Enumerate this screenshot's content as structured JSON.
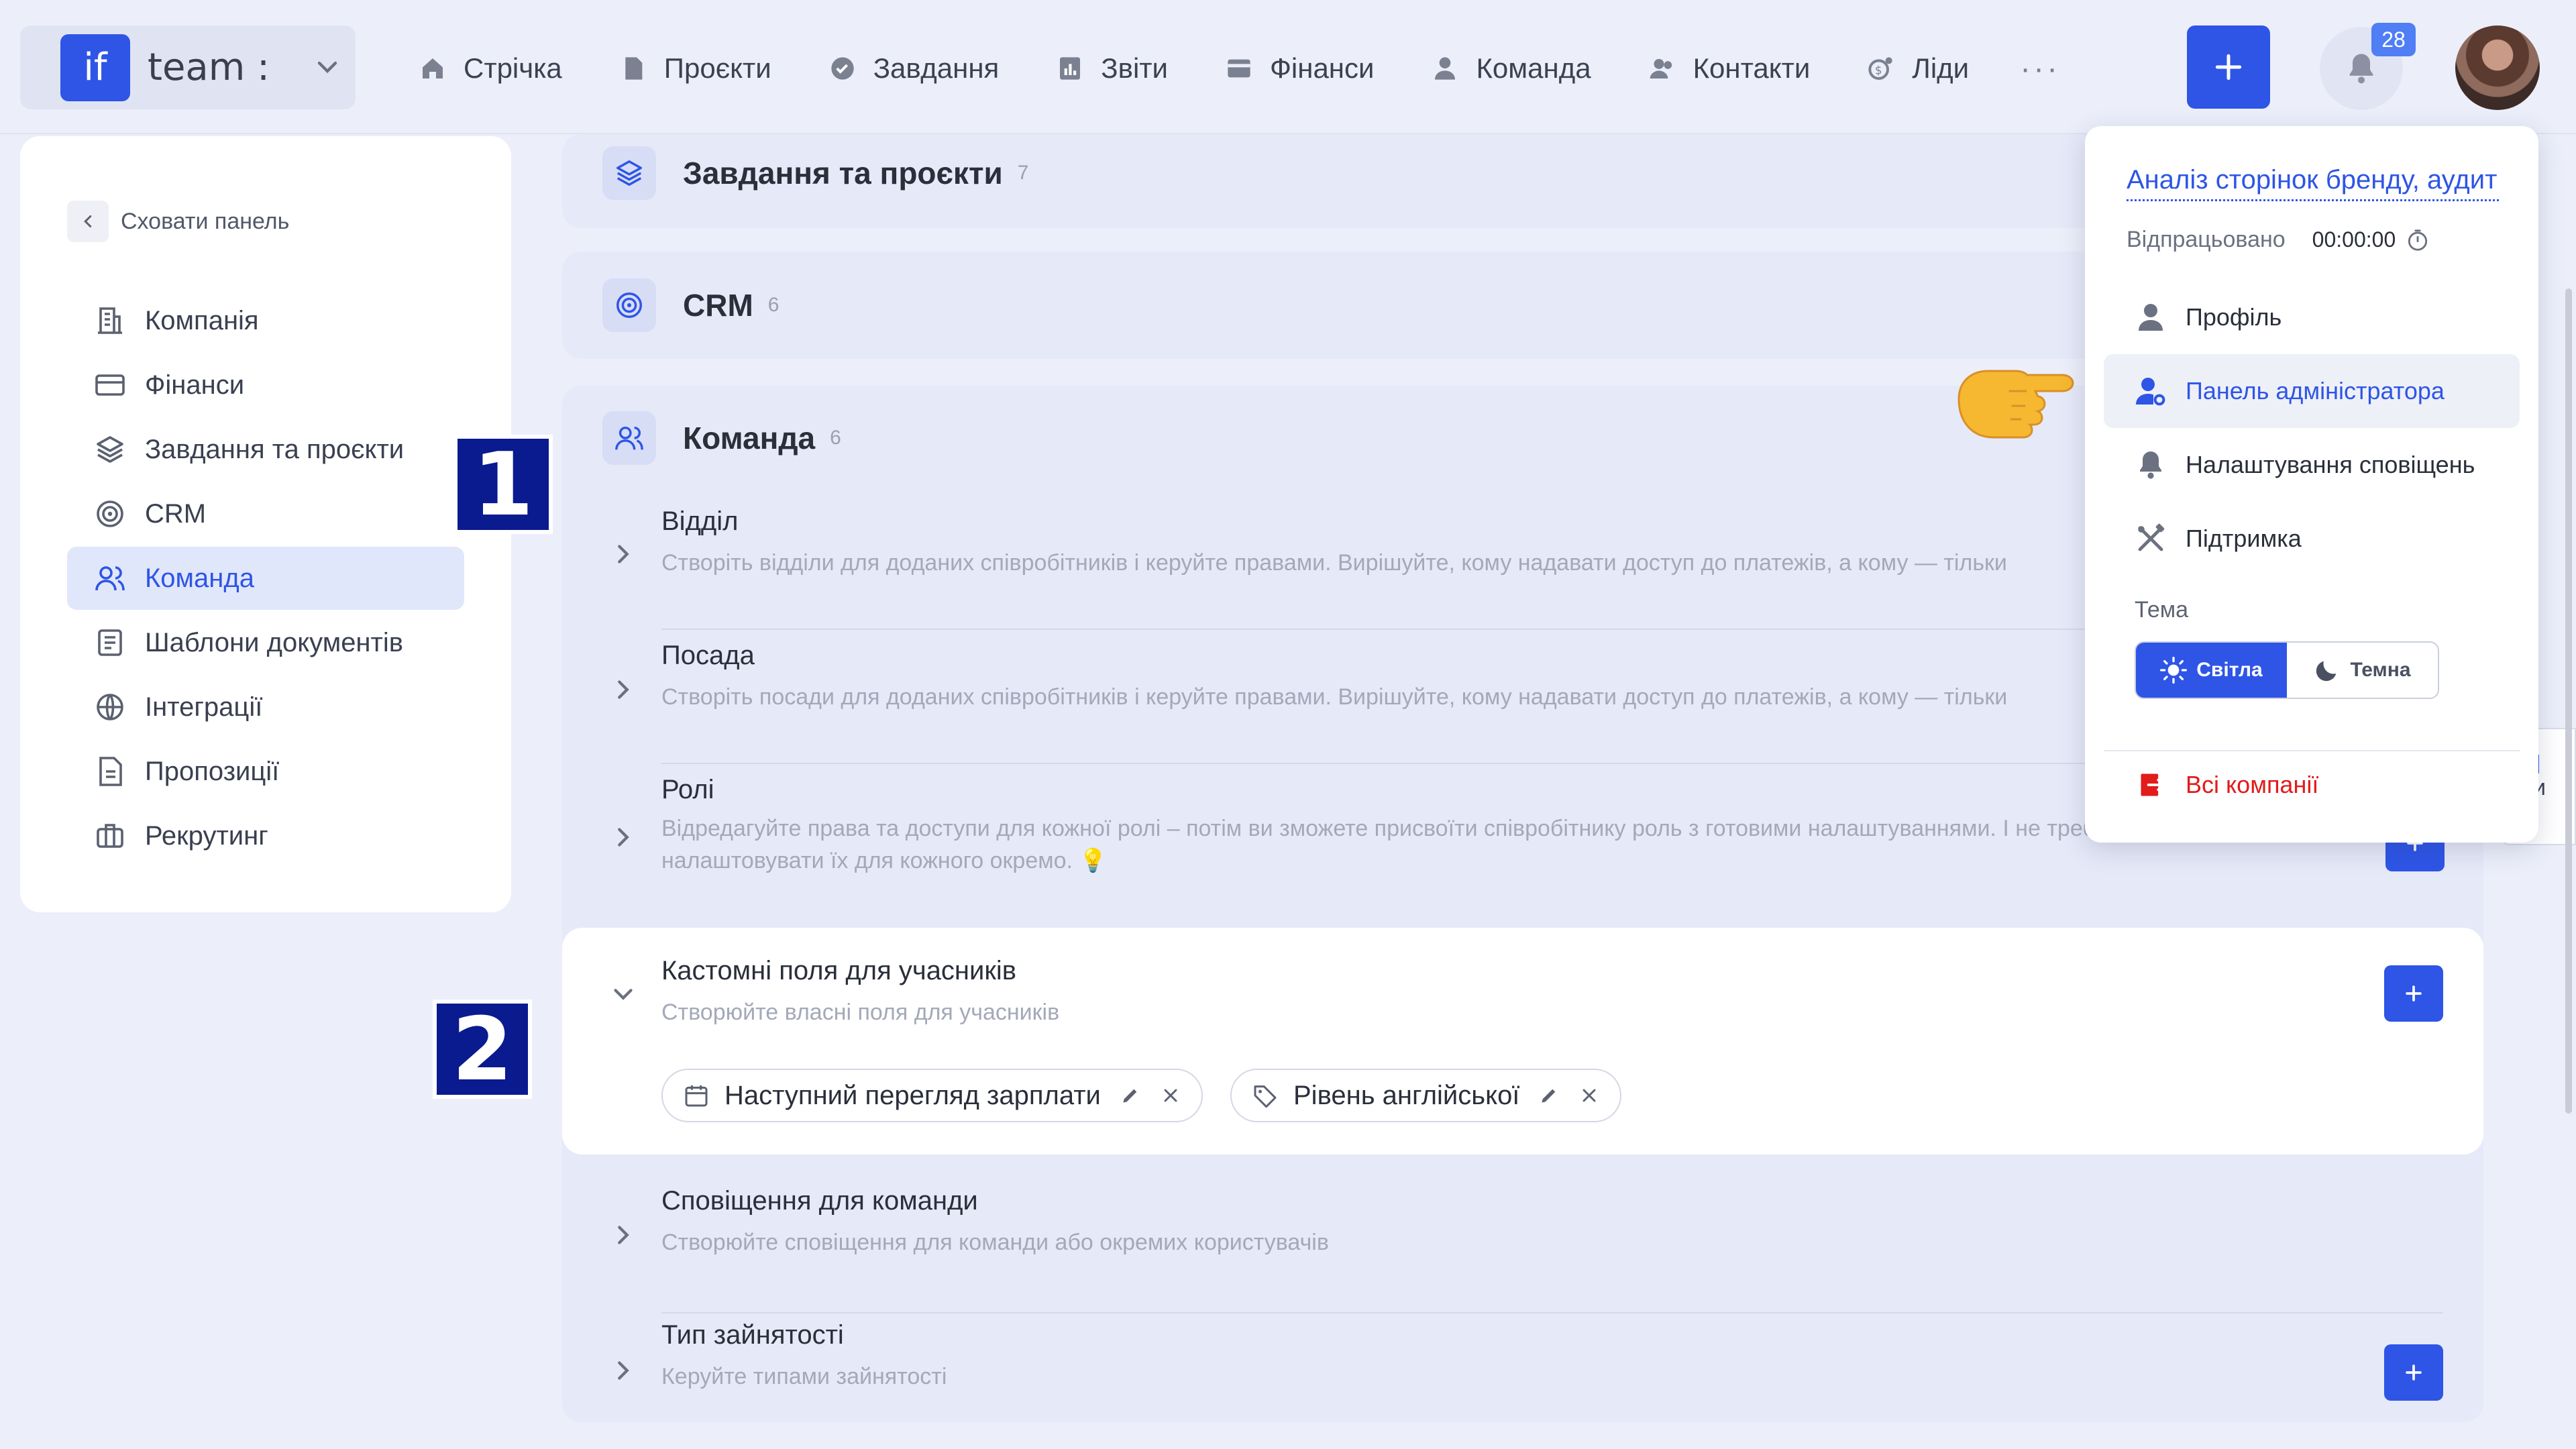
{
  "topbar": {
    "logo_text": "if",
    "team_name": "team :",
    "nav": [
      {
        "label": "Стрічка",
        "icon": "home-icon"
      },
      {
        "label": "Проєкти",
        "icon": "document-icon"
      },
      {
        "label": "Завдання",
        "icon": "check-circle-icon"
      },
      {
        "label": "Звіти",
        "icon": "report-icon"
      },
      {
        "label": "Фінанси",
        "icon": "wallet-icon"
      },
      {
        "label": "Команда",
        "icon": "user-icon"
      },
      {
        "label": "Контакти",
        "icon": "contacts-icon"
      },
      {
        "label": "Ліди",
        "icon": "leads-icon"
      }
    ],
    "more": "···",
    "notifications_count": "28",
    "accent": "#2e55e6"
  },
  "sidebar": {
    "hide_label": "Сховати панель",
    "items": [
      {
        "label": "Компанія",
        "icon": "company-icon"
      },
      {
        "label": "Фінанси",
        "icon": "card-icon"
      },
      {
        "label": "Завдання та проєкти",
        "icon": "layers-icon"
      },
      {
        "label": "CRM",
        "icon": "target-icon"
      },
      {
        "label": "Команда",
        "icon": "team-icon",
        "active": true
      },
      {
        "label": "Шаблони документів",
        "icon": "template-icon"
      },
      {
        "label": "Інтеграції",
        "icon": "globe-icon"
      },
      {
        "label": "Пропозиції",
        "icon": "proposal-icon"
      },
      {
        "label": "Рекрутинг",
        "icon": "briefcase-icon"
      }
    ]
  },
  "main": {
    "cards": [
      {
        "title": "Завдання та проєкти",
        "count": "7"
      },
      {
        "title": "CRM",
        "count": "6"
      },
      {
        "title": "Команда",
        "count": "6"
      }
    ],
    "rows": [
      {
        "title": "Відділ",
        "desc": "Створіть відділи для доданих співробітників і керуйте правами. Вирішуйте, кому надавати доступ до платежів, а кому — тільки"
      },
      {
        "title": "Посада",
        "desc": "Створіть посади для доданих співробітників і керуйте правами. Вирішуйте, кому надавати доступ до платежів, а кому — тільки"
      },
      {
        "title": "Ролі",
        "desc": "Відредагуйте права та доступи для кожної ролі – потім ви зможете присвоїти співробітнику роль з готовими налаштуваннями. І не треба щоразу налаштовувати їх для кожного окремо. 💡"
      },
      {
        "title": "Кастомні поля для учасників",
        "desc": "Створюйте власні поля для учасників"
      },
      {
        "title": "Сповіщення для команди",
        "desc": "Створюйте сповіщення для команди або окремих користувачів"
      },
      {
        "title": "Тип зайнятості",
        "desc": "Керуйте типами зайнятості"
      }
    ],
    "chips": [
      {
        "label": "Наступний перегляд зарплати",
        "icon": "calendar-icon"
      },
      {
        "label": "Рівень англійської",
        "icon": "tag-icon"
      }
    ]
  },
  "annotations": {
    "one": "1",
    "two": "2"
  },
  "dropdown": {
    "task": "Аналіз сторінок бренду, аудит",
    "worked_label": "Відпрацьовано",
    "worked_time": "00:00:00",
    "items": [
      {
        "label": "Профіль",
        "icon": "profile-icon"
      },
      {
        "label": "Панель адміністратора",
        "icon": "admin-icon"
      },
      {
        "label": "Налаштування сповіщень",
        "icon": "bell-icon"
      },
      {
        "label": "Підтримка",
        "icon": "tools-icon"
      }
    ],
    "theme_label": "Тема",
    "theme_light": "Світла",
    "theme_dark": "Темна",
    "companies": "Всі компанії",
    "companies_color": "#e21b1b"
  },
  "peek_text": "и"
}
